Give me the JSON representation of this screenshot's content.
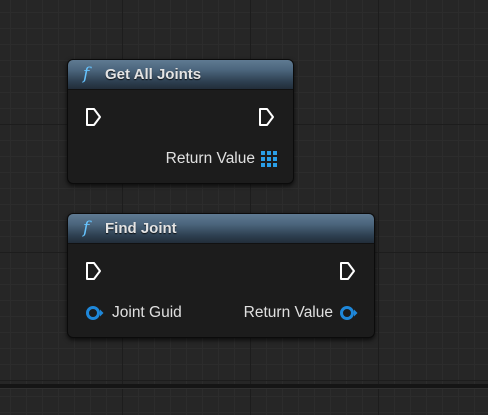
{
  "nodes": {
    "get_all_joints": {
      "title": "Get All Joints",
      "icon": "function-icon",
      "icon_glyph": "f",
      "return_label": "Return Value"
    },
    "find_joint": {
      "title": "Find Joint",
      "icon": "function-icon",
      "icon_glyph": "f",
      "input_label": "Joint Guid",
      "return_label": "Return Value"
    }
  },
  "colors": {
    "header": "#4b657c",
    "function_icon": "#66c4ff",
    "struct_pin": "#1e87d9",
    "array_pin": "#2a9fe8",
    "exec_pin": "#ffffff"
  }
}
